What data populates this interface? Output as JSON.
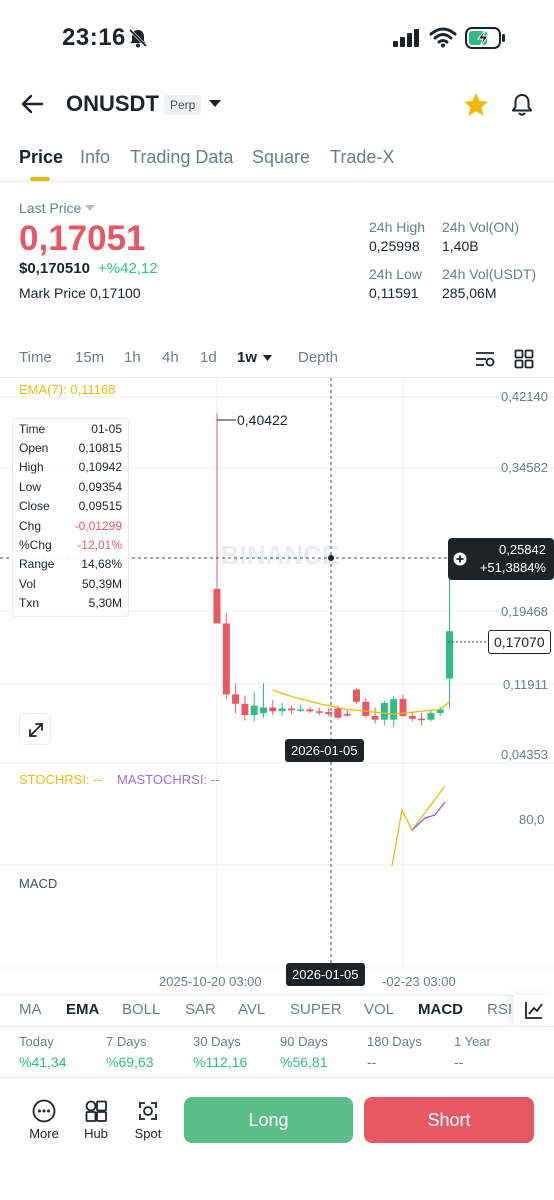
{
  "status": {
    "time": "23:16"
  },
  "header": {
    "symbol": "ONUSDT",
    "badge": "Perp"
  },
  "tabs": [
    "Price",
    "Info",
    "Trading Data",
    "Square",
    "Trade-X"
  ],
  "price": {
    "last_price_label": "Last Price",
    "last": "0,17051",
    "usd": "$0,170510",
    "change": "+%42,12",
    "mark_label": "Mark Price",
    "mark": "0,17100"
  },
  "stats": {
    "high_label": "24h High",
    "high": "0,25998",
    "vol_on_label": "24h Vol(ON)",
    "vol_on": "1,40B",
    "low_label": "24h Low",
    "low": "0,11591",
    "vol_usdt_label": "24h Vol(USDT)",
    "vol_usdt": "285,06M"
  },
  "intervals": [
    "Time",
    "15m",
    "1h",
    "4h",
    "1d",
    "1w",
    "Depth"
  ],
  "ema_label": "EMA(7): 0,11168",
  "y_axis": [
    "0,42140",
    "0,34582",
    "0,19468",
    "0,11911",
    "0,04353"
  ],
  "high_marker": "0,40422",
  "crosshair": {
    "price": "0,25842",
    "pct": "+51,3884%",
    "date": "2026-01-05"
  },
  "current_price_tag": "0,17070",
  "watermark": "BINANCE",
  "info_box": [
    [
      "Time",
      "01-05"
    ],
    [
      "Open",
      "0,10815"
    ],
    [
      "High",
      "0,10942"
    ],
    [
      "Low",
      "0,09354"
    ],
    [
      "Close",
      "0,09515"
    ],
    [
      "Chg",
      "-0,01299"
    ],
    [
      "%Chg",
      "-12,01%"
    ],
    [
      "Range",
      "14,68%"
    ],
    [
      "Vol",
      "50,39M"
    ],
    [
      "Txn",
      "5,30M"
    ]
  ],
  "stoch": {
    "label1": "STOCHRSI: --",
    "label2": "MASTOCHRSI: --",
    "level": "80,0"
  },
  "macd_label": "MACD",
  "x_axis": {
    "left": "2025-10-20 03:00",
    "right": "-02-23 03:00",
    "crosshair": "2026-01-05"
  },
  "indicators": [
    "MA",
    "EMA",
    "BOLL",
    "SAR",
    "AVL",
    "SUPER",
    "VOL",
    "MACD",
    "RSI"
  ],
  "performance": [
    {
      "label": "Today",
      "value": "%41,34"
    },
    {
      "label": "7 Days",
      "value": "%69,63"
    },
    {
      "label": "30 Days",
      "value": "%112,16"
    },
    {
      "label": "90 Days",
      "value": "%56,81"
    },
    {
      "label": "180 Days",
      "value": "--"
    },
    {
      "label": "1 Year",
      "value": "--"
    }
  ],
  "bottom": {
    "more": "More",
    "hub": "Hub",
    "spot": "Spot",
    "long": "Long",
    "short": "Short"
  },
  "colors": {
    "up": "#2ebd85",
    "down": "#e75865",
    "accent": "#f0b90b",
    "ema": "#f0b90b"
  },
  "chart_data": {
    "type": "candlestick",
    "ylim": [
      0.04353,
      0.4214
    ],
    "candles": [
      {
        "o": 0.216,
        "h": 0.4042,
        "l": 0.18,
        "c": 0.179
      },
      {
        "o": 0.179,
        "h": 0.19,
        "l": 0.098,
        "c": 0.103
      },
      {
        "o": 0.103,
        "h": 0.115,
        "l": 0.083,
        "c": 0.093
      },
      {
        "o": 0.093,
        "h": 0.102,
        "l": 0.075,
        "c": 0.081
      },
      {
        "o": 0.081,
        "h": 0.106,
        "l": 0.074,
        "c": 0.091
      },
      {
        "o": 0.083,
        "h": 0.115,
        "l": 0.078,
        "c": 0.089
      },
      {
        "o": 0.089,
        "h": 0.097,
        "l": 0.081,
        "c": 0.085
      },
      {
        "o": 0.085,
        "h": 0.094,
        "l": 0.08,
        "c": 0.088
      },
      {
        "o": 0.088,
        "h": 0.091,
        "l": 0.082,
        "c": 0.086
      },
      {
        "o": 0.086,
        "h": 0.092,
        "l": 0.084,
        "c": 0.087
      },
      {
        "o": 0.087,
        "h": 0.09,
        "l": 0.083,
        "c": 0.085
      },
      {
        "o": 0.085,
        "h": 0.089,
        "l": 0.081,
        "c": 0.084
      },
      {
        "o": 0.084,
        "h": 0.088,
        "l": 0.08,
        "c": 0.082
      },
      {
        "o": 0.088,
        "h": 0.091,
        "l": 0.076,
        "c": 0.078
      },
      {
        "o": 0.082,
        "h": 0.087,
        "l": 0.079,
        "c": 0.081
      },
      {
        "o": 0.1082,
        "h": 0.1094,
        "l": 0.0935,
        "c": 0.0952
      },
      {
        "o": 0.0952,
        "h": 0.099,
        "l": 0.078,
        "c": 0.08
      },
      {
        "o": 0.08,
        "h": 0.089,
        "l": 0.072,
        "c": 0.076
      },
      {
        "o": 0.076,
        "h": 0.096,
        "l": 0.07,
        "c": 0.094
      },
      {
        "o": 0.076,
        "h": 0.101,
        "l": 0.068,
        "c": 0.098
      },
      {
        "o": 0.098,
        "h": 0.103,
        "l": 0.079,
        "c": 0.08
      },
      {
        "o": 0.08,
        "h": 0.084,
        "l": 0.074,
        "c": 0.077
      },
      {
        "o": 0.077,
        "h": 0.083,
        "l": 0.07,
        "c": 0.076
      },
      {
        "o": 0.076,
        "h": 0.086,
        "l": 0.074,
        "c": 0.083
      },
      {
        "o": 0.083,
        "h": 0.09,
        "l": 0.08,
        "c": 0.087
      },
      {
        "o": 0.12,
        "h": 0.26,
        "l": 0.088,
        "c": 0.1707
      }
    ],
    "ema": [
      0.108,
      0.104,
      0.101,
      0.098,
      0.096,
      0.093,
      0.091,
      0.089,
      0.087,
      0.086,
      0.085,
      0.084,
      0.083,
      0.082,
      0.083,
      0.084,
      0.085,
      0.086,
      0.087,
      0.095
    ]
  }
}
